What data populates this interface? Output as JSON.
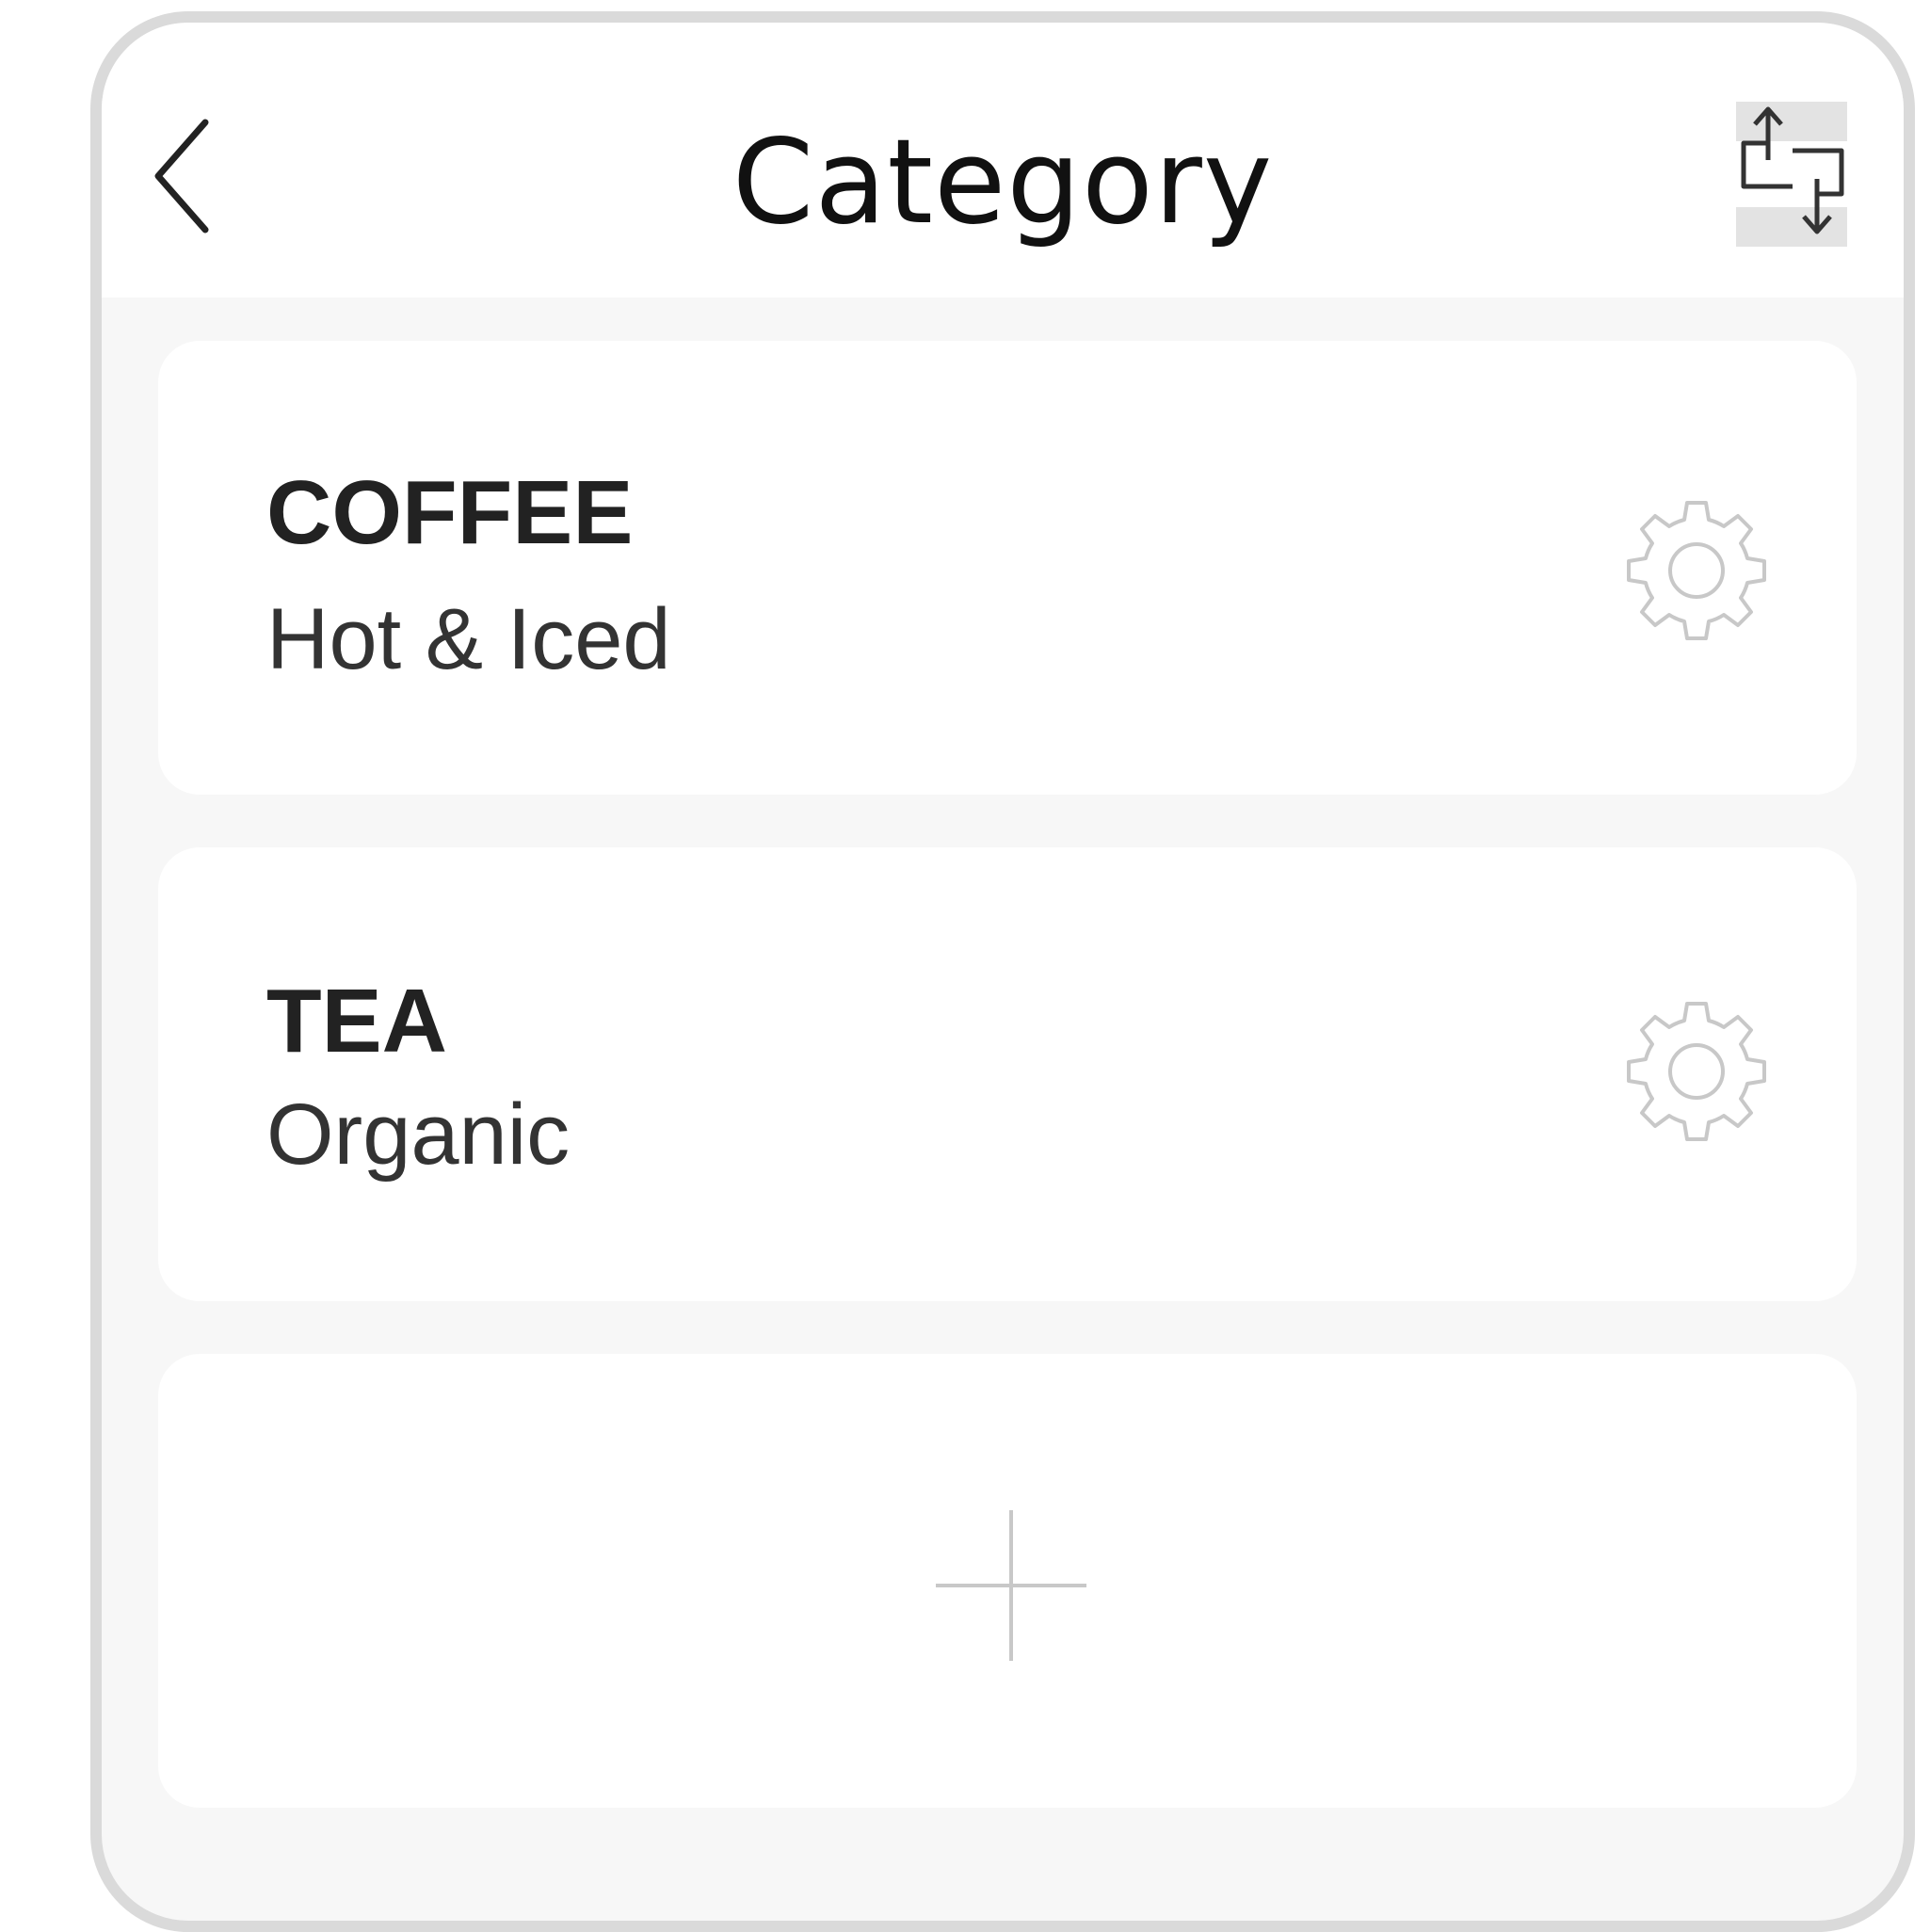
{
  "header": {
    "title": "Category",
    "back_icon": "chevron-left-icon",
    "sort_icon": "reorder-icon"
  },
  "categories": [
    {
      "name": "COFFEE",
      "subtitle": "Hot & Iced",
      "icon": "gear-icon"
    },
    {
      "name": "TEA",
      "subtitle": "Organic",
      "icon": "gear-icon"
    }
  ],
  "add_card": {
    "icon": "plus-icon"
  },
  "colors": {
    "background": "#f7f7f7",
    "card": "#ffffff",
    "frame": "#dadada",
    "icon_light": "#c8c8c8",
    "text_dark": "#222222"
  }
}
